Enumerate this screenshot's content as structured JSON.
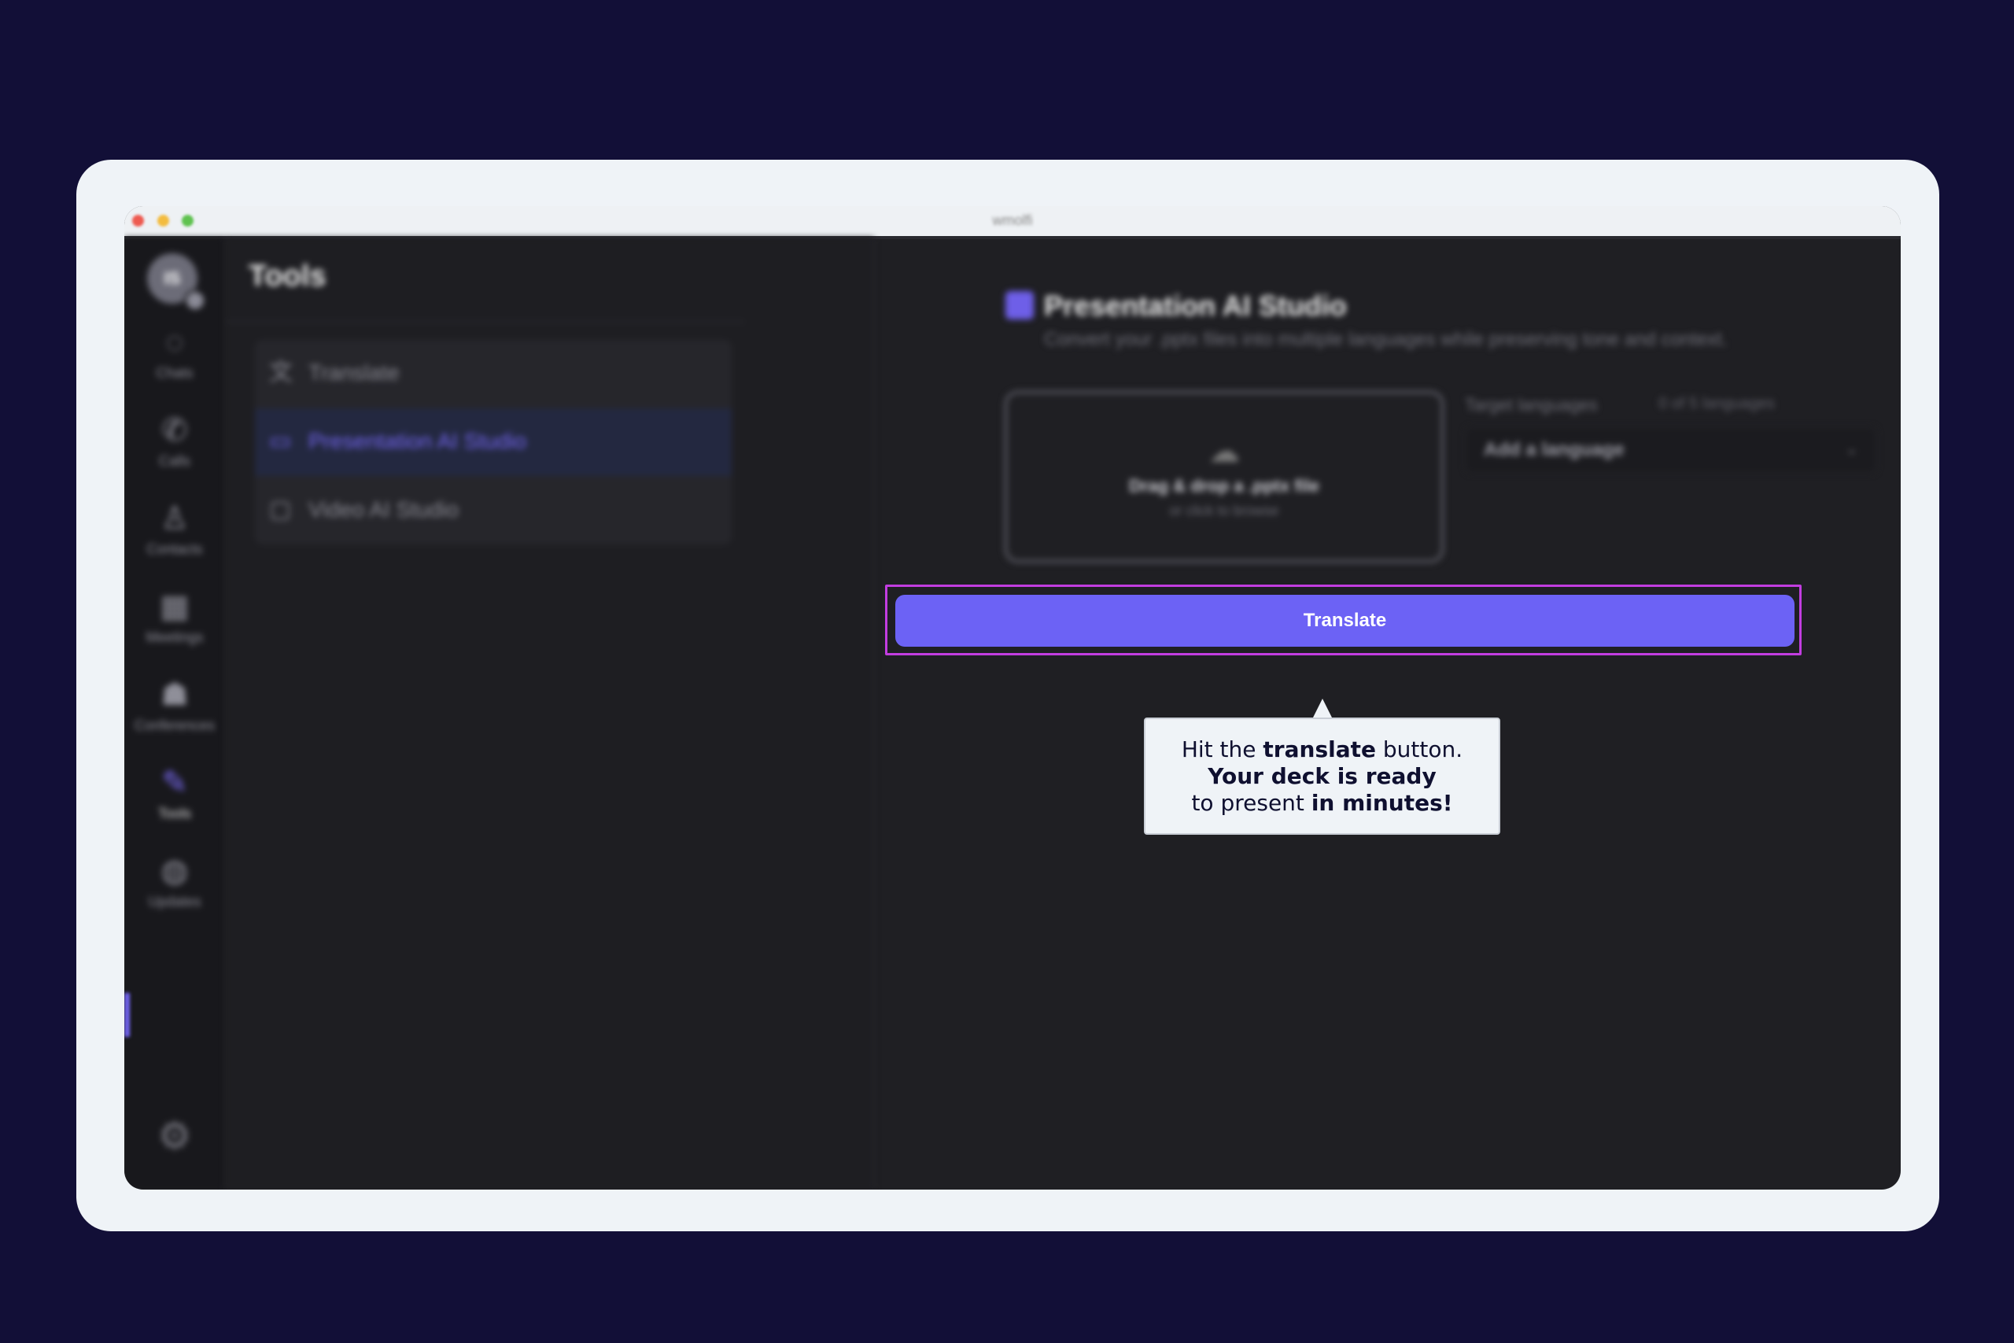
{
  "window": {
    "title": "wmolfi"
  },
  "rail": {
    "avatar_initials": "IS",
    "items": [
      {
        "label": "Chats",
        "icon": "chat-icon"
      },
      {
        "label": "Calls",
        "icon": "phone-icon"
      },
      {
        "label": "Contacts",
        "icon": "contacts-icon"
      },
      {
        "label": "Meetings",
        "icon": "calendar-icon"
      },
      {
        "label": "Conferences",
        "icon": "conference-icon"
      },
      {
        "label": "Tools",
        "icon": "tools-icon",
        "active": true
      },
      {
        "label": "Updates",
        "icon": "updates-icon"
      }
    ],
    "settings_icon": "gear-icon"
  },
  "tools": {
    "title": "Tools",
    "items": [
      {
        "label": "Translate",
        "icon": "translate-icon"
      },
      {
        "label": "Presentation AI Studio",
        "icon": "presentation-icon",
        "selected": true
      },
      {
        "label": "Video AI Studio",
        "icon": "video-icon"
      }
    ]
  },
  "main": {
    "title": "Presentation AI Studio",
    "subtitle": "Convert your .pptx files into multiple languages while preserving tone and context.",
    "dropzone": {
      "main": "Drag & drop a .pptx file",
      "sub": "or click to browse"
    },
    "target": {
      "label": "Target languages",
      "count": "0 of 5 languages",
      "placeholder": "Add a language"
    },
    "translate_button": "Translate"
  },
  "tooltip": {
    "line1_pre": "Hit the ",
    "line1_bold": "translate",
    "line1_post": " button.",
    "line2_bold": "Your deck is ready",
    "line3_pre": "to present ",
    "line3_bold": "in minutes!"
  },
  "colors": {
    "background": "#120f37",
    "accent": "#6c62f5",
    "highlight": "#c23de0"
  }
}
